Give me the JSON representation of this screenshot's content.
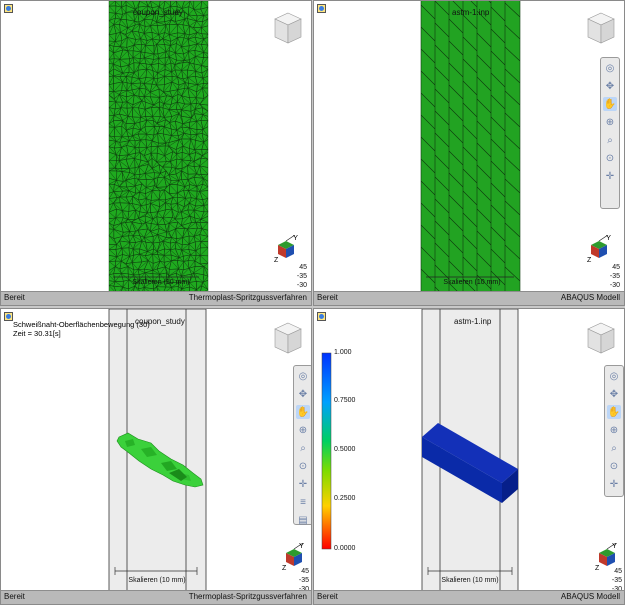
{
  "viewports": [
    {
      "id": "top-left",
      "title": "coupon_study",
      "status_left": "Bereit",
      "status_right": "Thermoplast-Spritzgussverfahren",
      "scale_label": "Skalieren (10 mm)",
      "triad": {
        "axis": "Y",
        "values": [
          "45",
          "-35",
          "-30"
        ]
      },
      "mesh_color": "#1faa1f"
    },
    {
      "id": "top-right",
      "title": "astm-1.inp",
      "status_left": "Bereit",
      "status_right": "ABAQUS Modell",
      "scale_label": "Skalieren (10 mm)",
      "triad": {
        "axis": "Y",
        "values": [
          "45",
          "-35",
          "-30"
        ]
      },
      "mesh_color": "#22a322"
    },
    {
      "id": "bottom-left",
      "title": "coupon_study",
      "annotation_line1": "Schweißnaht-Oberflächenbewegung (30)",
      "annotation_line2": "Zeit = 30.31[s]",
      "status_left": "Bereit",
      "status_right": "Thermoplast-Spritzgussverfahren",
      "scale_label": "Skalieren (10 mm)",
      "triad": {
        "axis": "Y",
        "values": [
          "45",
          "-35",
          "-30"
        ]
      }
    },
    {
      "id": "bottom-right",
      "title": "astm-1.inp",
      "status_left": "Bereit",
      "status_right": "ABAQUS Modell",
      "scale_label": "Skalieren (10 mm)",
      "triad": {
        "axis": "Y",
        "values": [
          "45",
          "-35",
          "-30"
        ]
      },
      "legend": {
        "labels": [
          "1.000",
          "0.7500",
          "0.5000",
          "0.2500",
          "0.0000"
        ]
      },
      "solid_color": "#0a2aa8"
    }
  ],
  "toolbar_icons": [
    "orbit-icon",
    "pan-icon",
    "hand-icon",
    "zoom-box-icon",
    "zoom-icon",
    "zoom-fit-icon",
    "axes-icon"
  ],
  "toolbar_icons_extended": [
    "orbit-icon",
    "pan-icon",
    "hand-icon",
    "zoom-box-icon",
    "zoom-icon",
    "zoom-fit-icon",
    "axes-icon",
    "layers-icon",
    "print-icon"
  ]
}
